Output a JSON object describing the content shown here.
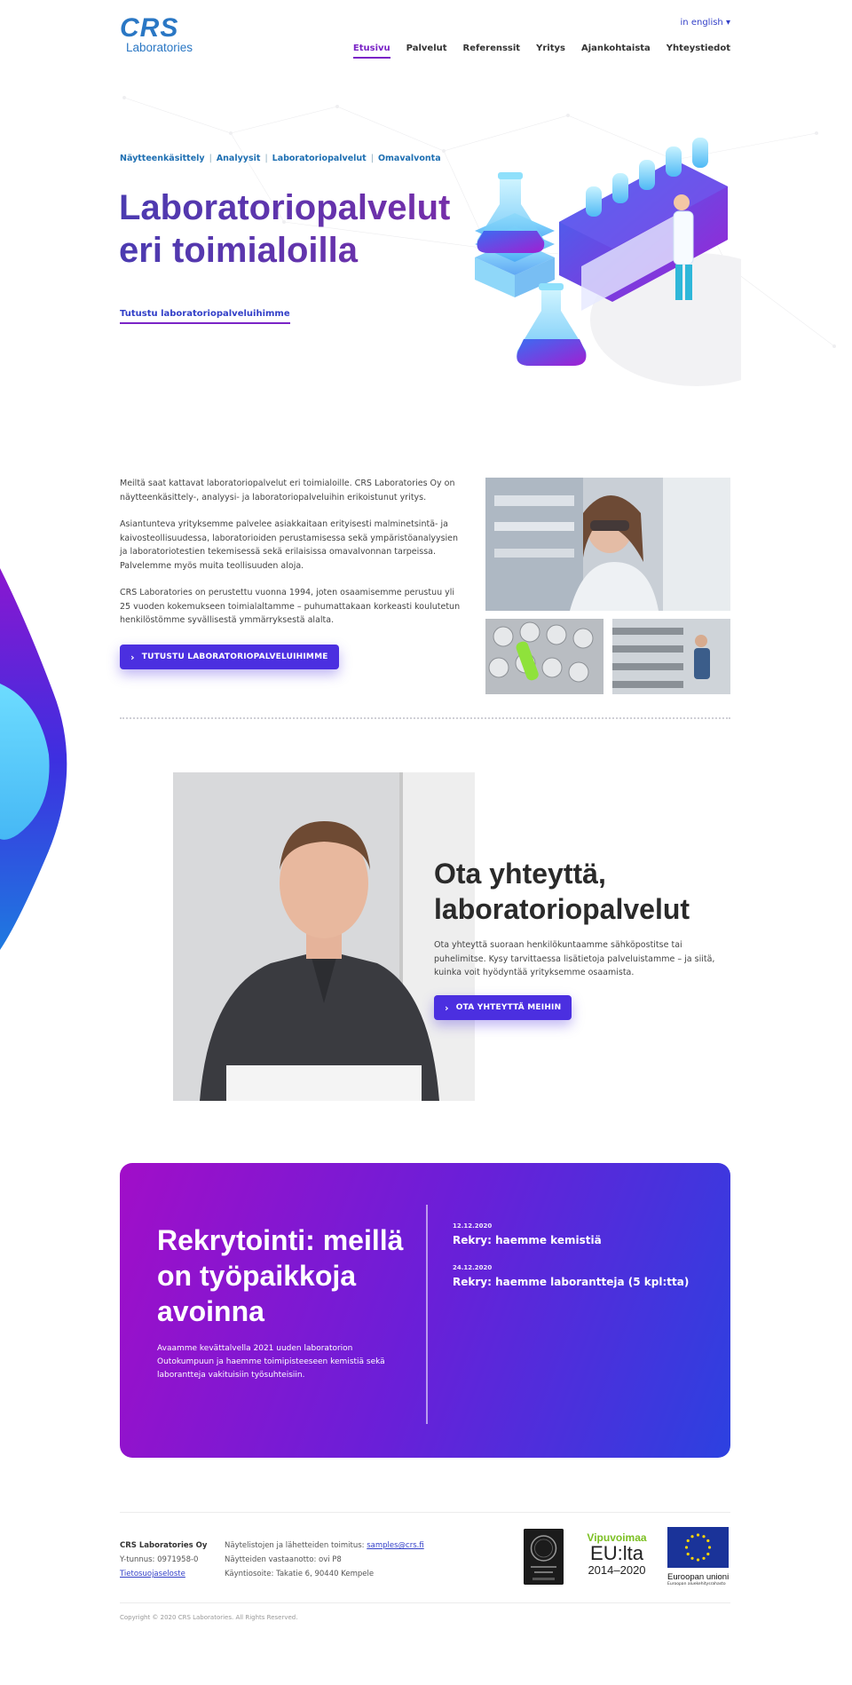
{
  "header": {
    "logo_main": "CRS",
    "logo_sub": "Laboratories",
    "language": "in english",
    "nav": [
      "Etusivu",
      "Palvelut",
      "Referenssit",
      "Yritys",
      "Ajankohtaista",
      "Yhteystiedot"
    ],
    "active_nav": "Etusivu"
  },
  "hero": {
    "breadcrumbs": [
      "Näytteenkäsittely",
      "Analyysit",
      "Laboratoriopalvelut",
      "Omavalvonta"
    ],
    "title_line1": "Laboratoriopalvelut",
    "title_line2": "eri toimialoilla",
    "link": "Tutustu laboratoriopalveluihimme"
  },
  "intro": {
    "paragraphs": [
      "Meiltä saat kattavat laboratoriopalvelut eri toimialoille. CRS Laboratories Oy on näytteenkäsittely-, analyysi- ja laboratoriopalveluihin erikoistunut yritys.",
      "Asiantunteva yrityksemme palvelee asiakkaitaan erityisesti malminetsintä- ja kaivosteollisuudessa, laboratorioiden perustamisessa sekä ympäristöanalyysien ja laboratoriotestien tekemisessä sekä erilaisissa omavalvonnan tarpeissa. Palvelemme myös muita teollisuuden aloja.",
      "CRS Laboratories on perustettu vuonna 1994, joten osaamisemme perustuu yli 25 vuoden kokemukseen toimialaltamme – puhumattakaan korkeasti koulutetun henkilöstömme syvällisestä ymmärryksestä alalta."
    ],
    "button": "TUTUSTU LABORATORIOPALVELUIHIMME"
  },
  "contact": {
    "title_line1": "Ota yhteyttä,",
    "title_line2": "laboratoriopalvelut",
    "text": "Ota yhteyttä suoraan henkilökuntaamme sähköpostitse tai puhelimitse. Kysy tarvittaessa lisätietoja palveluistamme – ja siitä, kuinka voit hyödyntää yrityksemme osaamista.",
    "button": "OTA YHTEYTTÄ MEIHIN"
  },
  "recruit": {
    "title": "Rekrytointi: meillä on työpaikkoja avoinna",
    "text": "Avaamme kevättalvella 2021 uuden laboratorion Outokumpuun ja haemme toimipisteeseen kemistiä sekä laborantteja vakituisiin työsuhteisiin.",
    "news": [
      {
        "date": "12.12.2020",
        "title": "Rekry: haemme kemistiä"
      },
      {
        "date": "24.12.2020",
        "title": "Rekry: haemme laborantteja (5 kpl:tta)"
      }
    ]
  },
  "footer": {
    "company": "CRS Laboratories Oy",
    "business_id": "Y-tunnus: 0971958-0",
    "privacy": "Tietosuojaseloste",
    "delivery_label": "Näytelistojen ja lähetteiden toimitus: ",
    "delivery_email": "samples@crs.fi",
    "reception": "Näytteiden vastaanotto: ovi P8",
    "address": "Käyntiosoite: Takatie 6, 90440 Kempele",
    "vip_top": "Vipuvoimaa",
    "vip_mid": "EU:lta",
    "vip_bot": "2014–2020",
    "eu_text": "Euroopan unioni",
    "eu_sub": "Euroopan aluekehitysrahasto",
    "copyright": "Copyright © 2020 CRS Laboratories. All Rights Reserved."
  },
  "colors": {
    "accent": "#4b2fe0",
    "purple": "#7a24c6",
    "link": "#3340c8",
    "logo": "#2a77c4"
  }
}
